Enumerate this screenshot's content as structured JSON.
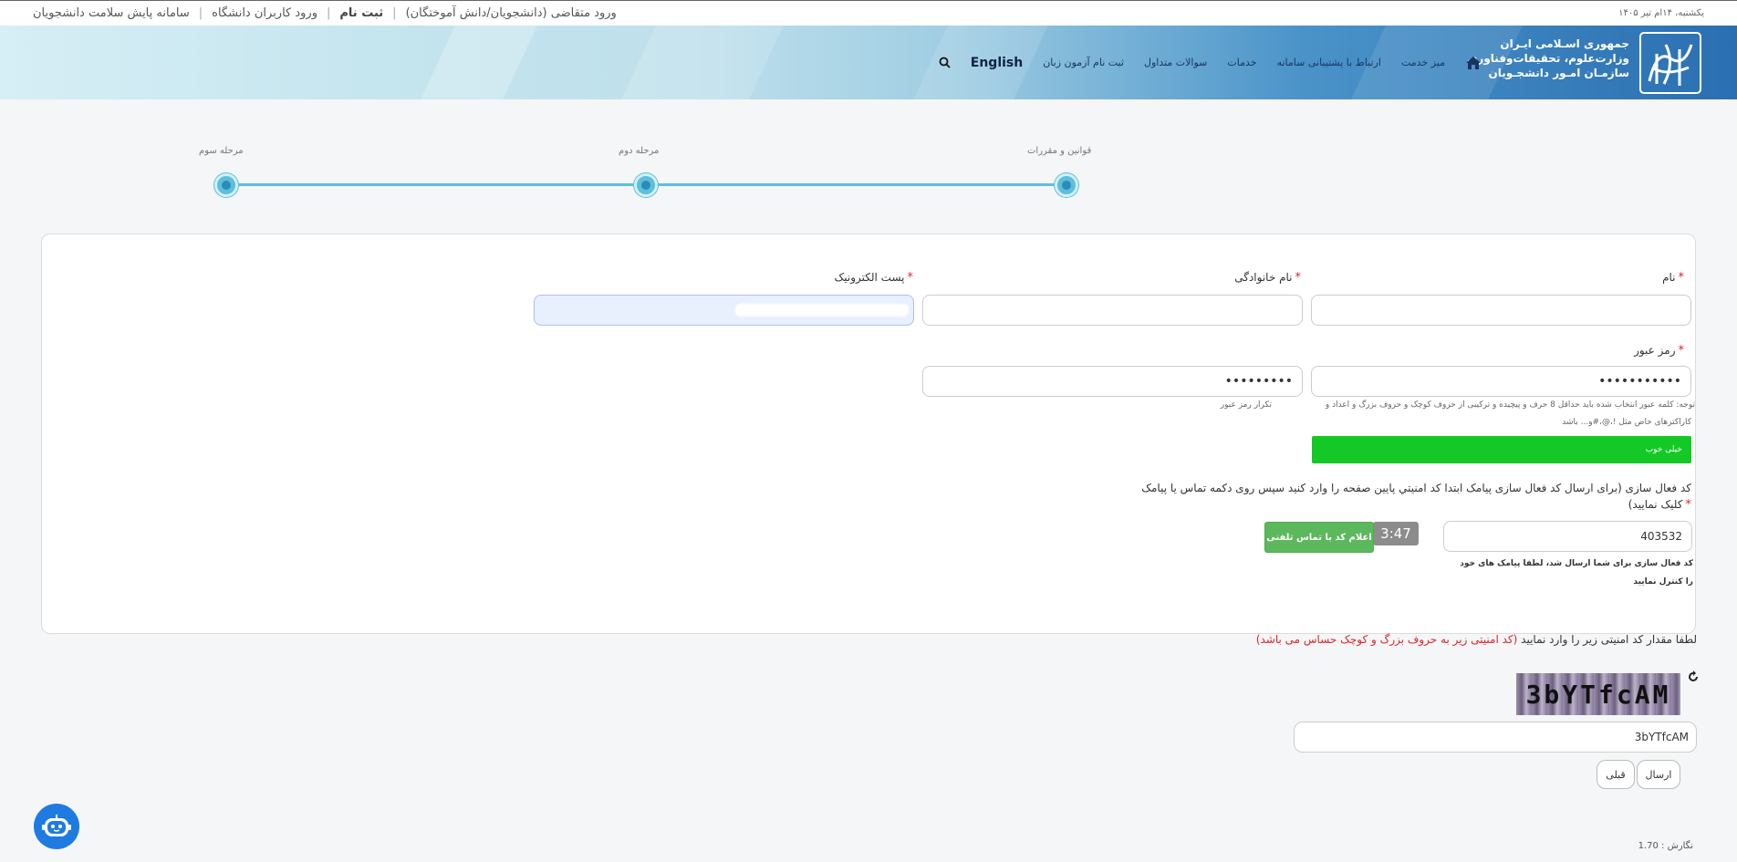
{
  "topbar": {
    "applicant_login": "ورود متقاضی (دانشجویان/دانش آموختگان)",
    "register": "ثبت نام",
    "university_login": "ورود کاربران دانشگاه",
    "health_system": "سامانه پایش سلامت دانشجویان",
    "date": "یکشنبه، ۱۴ام تیر ۱۴۰۵"
  },
  "header": {
    "org_line1": "جمهوری اسـلامی ایـران",
    "org_line2": "وزارت‌علوم، تحقیقات‌وفناوری",
    "org_line3": "سازمـان امـور دانشجـویان",
    "nav": [
      "میز خدمت",
      "ارتباط با پشتیبانی سامانه",
      "خدمات",
      "سوالات متداول",
      "ثبت نام آزمون زبان",
      "English"
    ]
  },
  "stepper": {
    "step1": "قوانین و مقررات",
    "step2": "مرحله دوم",
    "step3": "مرحله سوم"
  },
  "form": {
    "first_name_label": "نام",
    "last_name_label": "نام خانوادگی",
    "email_label": "پست الکترونیک",
    "password_label": "رمز عبور",
    "password_value": "•••••••••••",
    "password_repeat_value": "•••••••••",
    "password_hint_line1": "توجه: کلمه عبور انتخاب شده باید حداقل 8 حرف و پیچیده و ترکیبی از حروف کوچک و حروف بزرگ و اعداد و",
    "password_hint_line2": "کاراکترهای خاص مثل !،@،#و... باشد",
    "password_repeat_label": "تکرار رمز عبور",
    "strength": "خیلی خوب",
    "activation_label_line1": "کد فعال سازی (برای ارسال کد فعال سازی پیامک ابتدا کد امنيتي پايين صفحه را وارد کنيد سپس روی دکمه تماس یا پیامک",
    "activation_label_line2": "کلیک نمایید)",
    "activation_value": "403532",
    "timer": "3:47",
    "call_button": "اعلام کد با تماس تلفنی",
    "sent_message": "کد فعال سازی برای شما ارسال شد، لطفا پیامک های خود را کنترل نمایید"
  },
  "captcha": {
    "prompt": "لطفا مقدار کد امنیتی زیر را وارد نمایید",
    "note": "(کد امنیتی زیر به حروف بزرگ و کوچک حساس می باشد)",
    "image_text": "3bYTfcAM",
    "value": "3bYTfcAM"
  },
  "buttons": {
    "submit": "ارسال",
    "previous": "قبلی"
  },
  "footer": {
    "version": "نگارش : 1.70"
  },
  "colors": {
    "accent": "#5bc0de",
    "strength_good": "#14c925",
    "call_button": "#5cb85c",
    "required": "#d9252b"
  }
}
